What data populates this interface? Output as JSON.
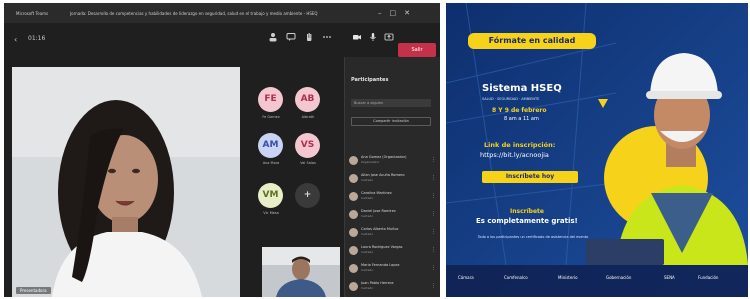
{
  "teams": {
    "window": {
      "app_name": "Microsoft Teams",
      "meeting_title": "Jornada: Desarrollo de competencias y habilidades de liderazgo en seguridad, salud en el trabajo y medio ambiente - HSEQ",
      "controls": [
        "–",
        "□",
        "✕"
      ]
    },
    "toolbar": {
      "back_glyph": "‹",
      "timer": "01:16",
      "leave_label": "Salir",
      "icons": [
        "people-icon",
        "chat-icon",
        "raise-hand-icon",
        "more-icon",
        "camera-icon",
        "mic-icon",
        "share-icon"
      ]
    },
    "main_video": {
      "name": "Presentadora"
    },
    "avatars": [
      {
        "initials": "FE",
        "label": "Fe Gomez",
        "color": "#f4c6d0",
        "text_color": "#b03050"
      },
      {
        "initials": "AB",
        "label": "Aibrath",
        "color": "#f4c6d0",
        "text_color": "#b03050"
      },
      {
        "initials": "AM",
        "label": "Ana Mora",
        "color": "#c9d3f4",
        "text_color": "#3a4ea8"
      },
      {
        "initials": "VS",
        "label": "Val Salas",
        "color": "#f4c6d0",
        "text_color": "#b03050"
      },
      {
        "initials": "VM",
        "label": "Vic Mesa",
        "color": "#e8efc8",
        "text_color": "#5c7020"
      },
      {
        "initials": "+",
        "label": "",
        "color": "#3a3a3a",
        "text_color": "#dcdcdc"
      }
    ],
    "participants_panel": {
      "title": "Participantes",
      "search_placeholder": "Buscar a alguien",
      "share_label": "Compartir invitación",
      "rows": [
        {
          "name": "Ana Gomez (Organizador)",
          "sub": "Organizador"
        },
        {
          "name": "Allan Jose Acuña Romero",
          "sub": "Invitado"
        },
        {
          "name": "Carolina Martinez",
          "sub": "Invitado"
        },
        {
          "name": "Daniel Jose Ramirez",
          "sub": "Invitado"
        },
        {
          "name": "Carlos Alberto Muñoz",
          "sub": "Invitado"
        },
        {
          "name": "Laura Rodriguez Vargas",
          "sub": "Invitado"
        },
        {
          "name": "Maria Fernanda Lopez",
          "sub": "Invitado"
        },
        {
          "name": "Juan Pablo Herrera",
          "sub": "Invitado"
        }
      ]
    }
  },
  "banner": {
    "tag": "Fórmate en calidad",
    "title": "Sistema HSEQ",
    "subtitle": "SALUD · SEGURIDAD · AMBIENTE",
    "dates": "8 Y 9 de febrero",
    "time": "8 am a 11 am",
    "link_label": "Link de inscripción:",
    "link_url": "https://bit.ly/acnoojia",
    "cta": "Inscríbete hoy",
    "free_label": "Inscríbete",
    "free_text": "Es completamente gratis!",
    "fine_print": "Todo a los participantes un certificado de asistencia del evento",
    "logos": [
      "Cámara",
      "Comfenalco",
      "Ministerio",
      "Gobernación",
      "SENA",
      "Fundación"
    ],
    "colors": {
      "navy": "#123a7c",
      "yellow": "#f7d21a",
      "vest": "#c8e619"
    }
  }
}
